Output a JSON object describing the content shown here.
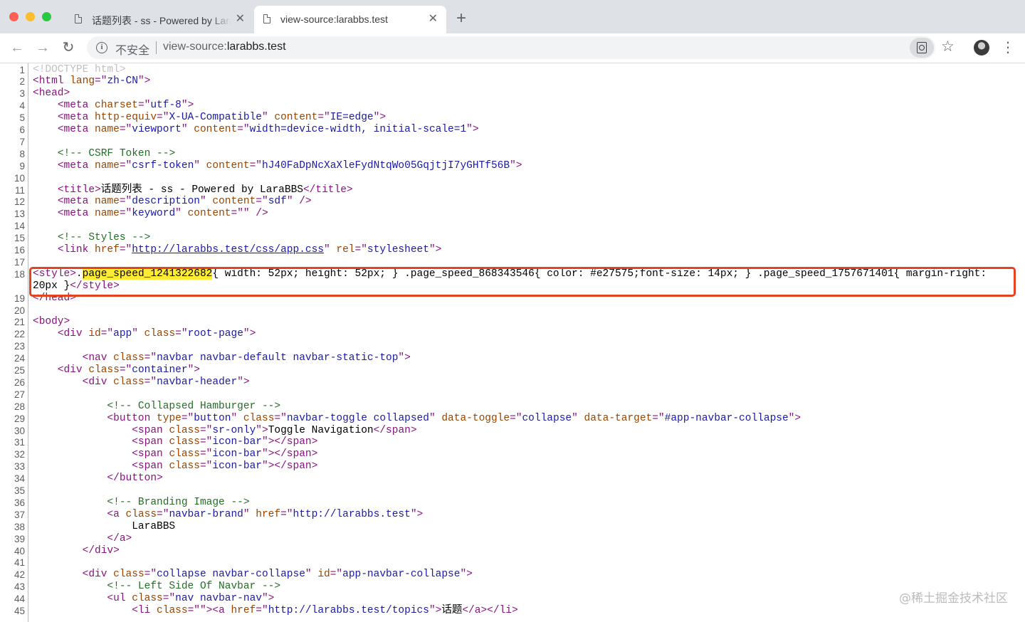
{
  "browser": {
    "tabs": [
      {
        "title": "话题列表 - ss - Powered by LaraBBS",
        "active": false
      },
      {
        "title": "view-source:larabbs.test",
        "active": true
      }
    ],
    "address_bar": {
      "security_label": "不安全",
      "url_scheme": "view-source:",
      "url_host": "larabbs.test"
    },
    "icons": {
      "back": "arrow-left-icon",
      "forward": "arrow-right-icon",
      "reload": "reload-icon",
      "info": "info-icon",
      "lens": "search-page-icon",
      "bookmark": "star-icon",
      "profile": "avatar",
      "menu": "kebab-menu-icon",
      "new_tab": "plus-icon",
      "close_tab": "close-icon"
    }
  },
  "source": {
    "lines": [
      {
        "n": "1",
        "tokens": [
          [
            "dt",
            "<!DOCTYPE html>"
          ]
        ]
      },
      {
        "n": "2",
        "tokens": [
          [
            "t",
            "<html "
          ],
          [
            "an",
            "lang"
          ],
          [
            "t",
            "=\""
          ],
          [
            "av",
            "zh-CN"
          ],
          [
            "t",
            "\">"
          ]
        ]
      },
      {
        "n": "3",
        "tokens": [
          [
            "t",
            "<head>"
          ]
        ]
      },
      {
        "n": "4",
        "tokens": [
          [
            "",
            "    "
          ],
          [
            "t",
            "<meta "
          ],
          [
            "an",
            "charset"
          ],
          [
            "t",
            "=\""
          ],
          [
            "av",
            "utf-8"
          ],
          [
            "t",
            "\">"
          ]
        ]
      },
      {
        "n": "5",
        "tokens": [
          [
            "",
            "    "
          ],
          [
            "t",
            "<meta "
          ],
          [
            "an",
            "http-equiv"
          ],
          [
            "t",
            "=\""
          ],
          [
            "av",
            "X-UA-Compatible"
          ],
          [
            "t",
            "\" "
          ],
          [
            "an",
            "content"
          ],
          [
            "t",
            "=\""
          ],
          [
            "av",
            "IE=edge"
          ],
          [
            "t",
            "\">"
          ]
        ]
      },
      {
        "n": "6",
        "tokens": [
          [
            "",
            "    "
          ],
          [
            "t",
            "<meta "
          ],
          [
            "an",
            "name"
          ],
          [
            "t",
            "=\""
          ],
          [
            "av",
            "viewport"
          ],
          [
            "t",
            "\" "
          ],
          [
            "an",
            "content"
          ],
          [
            "t",
            "=\""
          ],
          [
            "av",
            "width=device-width, initial-scale=1"
          ],
          [
            "t",
            "\">"
          ]
        ]
      },
      {
        "n": "7",
        "tokens": []
      },
      {
        "n": "8",
        "tokens": [
          [
            "",
            "    "
          ],
          [
            "cm",
            "<!-- CSRF Token -->"
          ]
        ]
      },
      {
        "n": "9",
        "tokens": [
          [
            "",
            "    "
          ],
          [
            "t",
            "<meta "
          ],
          [
            "an",
            "name"
          ],
          [
            "t",
            "=\""
          ],
          [
            "av",
            "csrf-token"
          ],
          [
            "t",
            "\" "
          ],
          [
            "an",
            "content"
          ],
          [
            "t",
            "=\""
          ],
          [
            "av",
            "hJ40FaDpNcXaXleFydNtqWo05GqjtjI7yGHTf56B"
          ],
          [
            "t",
            "\">"
          ]
        ]
      },
      {
        "n": "10",
        "tokens": []
      },
      {
        "n": "11",
        "tokens": [
          [
            "",
            "    "
          ],
          [
            "t",
            "<title>"
          ],
          [
            "",
            "话题列表 - ss - Powered by LaraBBS"
          ],
          [
            "t",
            "</title>"
          ]
        ]
      },
      {
        "n": "12",
        "tokens": [
          [
            "",
            "    "
          ],
          [
            "t",
            "<meta "
          ],
          [
            "an",
            "name"
          ],
          [
            "t",
            "=\""
          ],
          [
            "av",
            "description"
          ],
          [
            "t",
            "\" "
          ],
          [
            "an",
            "content"
          ],
          [
            "t",
            "=\""
          ],
          [
            "av",
            "sdf"
          ],
          [
            "t",
            "\" />"
          ]
        ]
      },
      {
        "n": "13",
        "tokens": [
          [
            "",
            "    "
          ],
          [
            "t",
            "<meta "
          ],
          [
            "an",
            "name"
          ],
          [
            "t",
            "=\""
          ],
          [
            "av",
            "keyword"
          ],
          [
            "t",
            "\" "
          ],
          [
            "an",
            "content"
          ],
          [
            "t",
            "=\"\" />"
          ]
        ]
      },
      {
        "n": "14",
        "tokens": []
      },
      {
        "n": "15",
        "tokens": [
          [
            "",
            "    "
          ],
          [
            "cm",
            "<!-- Styles -->"
          ]
        ]
      },
      {
        "n": "16",
        "tokens": [
          [
            "",
            "    "
          ],
          [
            "t",
            "<link "
          ],
          [
            "an",
            "href"
          ],
          [
            "t",
            "=\""
          ],
          [
            "lk",
            "http://larabbs.test/css/app.css"
          ],
          [
            "t",
            "\" "
          ],
          [
            "an",
            "rel"
          ],
          [
            "t",
            "=\""
          ],
          [
            "av",
            "stylesheet"
          ],
          [
            "t",
            "\">"
          ]
        ]
      },
      {
        "n": "17",
        "tokens": []
      },
      {
        "n": "18",
        "tokens": [
          [
            "t",
            "<style>"
          ],
          [
            "",
            "."
          ],
          [
            "hl",
            "page_speed_1241322682"
          ],
          [
            "",
            "{ width: 52px; height: 52px; } .page_speed_868343546{ color: #e27575;font-size: 14px; } .page_speed_1757671401{ margin-right:"
          ]
        ]
      },
      {
        "n": "",
        "tokens": [
          [
            "",
            "20px }"
          ],
          [
            "t",
            "</style>"
          ]
        ]
      },
      {
        "n": "19",
        "tokens": [
          [
            "t",
            "</head>"
          ]
        ]
      },
      {
        "n": "20",
        "tokens": []
      },
      {
        "n": "21",
        "tokens": [
          [
            "t",
            "<body>"
          ]
        ]
      },
      {
        "n": "22",
        "tokens": [
          [
            "",
            "    "
          ],
          [
            "t",
            "<div "
          ],
          [
            "an",
            "id"
          ],
          [
            "t",
            "=\""
          ],
          [
            "av",
            "app"
          ],
          [
            "t",
            "\" "
          ],
          [
            "an",
            "class"
          ],
          [
            "t",
            "=\""
          ],
          [
            "av",
            "root-page"
          ],
          [
            "t",
            "\">"
          ]
        ]
      },
      {
        "n": "23",
        "tokens": []
      },
      {
        "n": "24",
        "tokens": [
          [
            "",
            "        "
          ],
          [
            "t",
            "<nav "
          ],
          [
            "an",
            "class"
          ],
          [
            "t",
            "=\""
          ],
          [
            "av",
            "navbar navbar-default navbar-static-top"
          ],
          [
            "t",
            "\">"
          ]
        ]
      },
      {
        "n": "25",
        "tokens": [
          [
            "",
            "    "
          ],
          [
            "t",
            "<div "
          ],
          [
            "an",
            "class"
          ],
          [
            "t",
            "=\""
          ],
          [
            "av",
            "container"
          ],
          [
            "t",
            "\">"
          ]
        ]
      },
      {
        "n": "26",
        "tokens": [
          [
            "",
            "        "
          ],
          [
            "t",
            "<div "
          ],
          [
            "an",
            "class"
          ],
          [
            "t",
            "=\""
          ],
          [
            "av",
            "navbar-header"
          ],
          [
            "t",
            "\">"
          ]
        ]
      },
      {
        "n": "27",
        "tokens": []
      },
      {
        "n": "28",
        "tokens": [
          [
            "",
            "            "
          ],
          [
            "cm",
            "<!-- Collapsed Hamburger -->"
          ]
        ]
      },
      {
        "n": "29",
        "tokens": [
          [
            "",
            "            "
          ],
          [
            "t",
            "<button "
          ],
          [
            "an",
            "type"
          ],
          [
            "t",
            "=\""
          ],
          [
            "av",
            "button"
          ],
          [
            "t",
            "\" "
          ],
          [
            "an",
            "class"
          ],
          [
            "t",
            "=\""
          ],
          [
            "av",
            "navbar-toggle collapsed"
          ],
          [
            "t",
            "\" "
          ],
          [
            "an",
            "data-toggle"
          ],
          [
            "t",
            "=\""
          ],
          [
            "av",
            "collapse"
          ],
          [
            "t",
            "\" "
          ],
          [
            "an",
            "data-target"
          ],
          [
            "t",
            "=\""
          ],
          [
            "av",
            "#app-navbar-collapse"
          ],
          [
            "t",
            "\">"
          ]
        ]
      },
      {
        "n": "30",
        "tokens": [
          [
            "",
            "                "
          ],
          [
            "t",
            "<span "
          ],
          [
            "an",
            "class"
          ],
          [
            "t",
            "=\""
          ],
          [
            "av",
            "sr-only"
          ],
          [
            "t",
            "\">"
          ],
          [
            "",
            "Toggle Navigation"
          ],
          [
            "t",
            "</span>"
          ]
        ]
      },
      {
        "n": "31",
        "tokens": [
          [
            "",
            "                "
          ],
          [
            "t",
            "<span "
          ],
          [
            "an",
            "class"
          ],
          [
            "t",
            "=\""
          ],
          [
            "av",
            "icon-bar"
          ],
          [
            "t",
            "\"></span>"
          ]
        ]
      },
      {
        "n": "32",
        "tokens": [
          [
            "",
            "                "
          ],
          [
            "t",
            "<span "
          ],
          [
            "an",
            "class"
          ],
          [
            "t",
            "=\""
          ],
          [
            "av",
            "icon-bar"
          ],
          [
            "t",
            "\"></span>"
          ]
        ]
      },
      {
        "n": "33",
        "tokens": [
          [
            "",
            "                "
          ],
          [
            "t",
            "<span "
          ],
          [
            "an",
            "class"
          ],
          [
            "t",
            "=\""
          ],
          [
            "av",
            "icon-bar"
          ],
          [
            "t",
            "\"></span>"
          ]
        ]
      },
      {
        "n": "34",
        "tokens": [
          [
            "",
            "            "
          ],
          [
            "t",
            "</button>"
          ]
        ]
      },
      {
        "n": "35",
        "tokens": []
      },
      {
        "n": "36",
        "tokens": [
          [
            "",
            "            "
          ],
          [
            "cm",
            "<!-- Branding Image -->"
          ]
        ]
      },
      {
        "n": "37",
        "tokens": [
          [
            "",
            "            "
          ],
          [
            "t",
            "<a "
          ],
          [
            "an",
            "class"
          ],
          [
            "t",
            "=\""
          ],
          [
            "av",
            "navbar-brand"
          ],
          [
            "t",
            "\" "
          ],
          [
            "an",
            "href"
          ],
          [
            "t",
            "=\""
          ],
          [
            "av",
            "http://larabbs.test"
          ],
          [
            "t",
            "\">"
          ]
        ]
      },
      {
        "n": "38",
        "tokens": [
          [
            "",
            "                LaraBBS"
          ]
        ]
      },
      {
        "n": "39",
        "tokens": [
          [
            "",
            "            "
          ],
          [
            "t",
            "</a>"
          ]
        ]
      },
      {
        "n": "40",
        "tokens": [
          [
            "",
            "        "
          ],
          [
            "t",
            "</div>"
          ]
        ]
      },
      {
        "n": "41",
        "tokens": []
      },
      {
        "n": "42",
        "tokens": [
          [
            "",
            "        "
          ],
          [
            "t",
            "<div "
          ],
          [
            "an",
            "class"
          ],
          [
            "t",
            "=\""
          ],
          [
            "av",
            "collapse navbar-collapse"
          ],
          [
            "t",
            "\" "
          ],
          [
            "an",
            "id"
          ],
          [
            "t",
            "=\""
          ],
          [
            "av",
            "app-navbar-collapse"
          ],
          [
            "t",
            "\">"
          ]
        ]
      },
      {
        "n": "43",
        "tokens": [
          [
            "",
            "            "
          ],
          [
            "cm",
            "<!-- Left Side Of Navbar -->"
          ]
        ]
      },
      {
        "n": "44",
        "tokens": [
          [
            "",
            "            "
          ],
          [
            "t",
            "<ul "
          ],
          [
            "an",
            "class"
          ],
          [
            "t",
            "=\""
          ],
          [
            "av",
            "nav navbar-nav"
          ],
          [
            "t",
            "\">"
          ]
        ]
      },
      {
        "n": "45",
        "tokens": [
          [
            "",
            "                "
          ],
          [
            "t",
            "<li "
          ],
          [
            "an",
            "class"
          ],
          [
            "t",
            "=\"\"><a "
          ],
          [
            "an",
            "href"
          ],
          [
            "t",
            "=\""
          ],
          [
            "av",
            "http://larabbs.test/topics"
          ],
          [
            "t",
            "\">"
          ],
          [
            "",
            "话题"
          ],
          [
            "t",
            "</a></li>"
          ]
        ]
      }
    ]
  },
  "watermark": "@稀土掘金技术社区"
}
